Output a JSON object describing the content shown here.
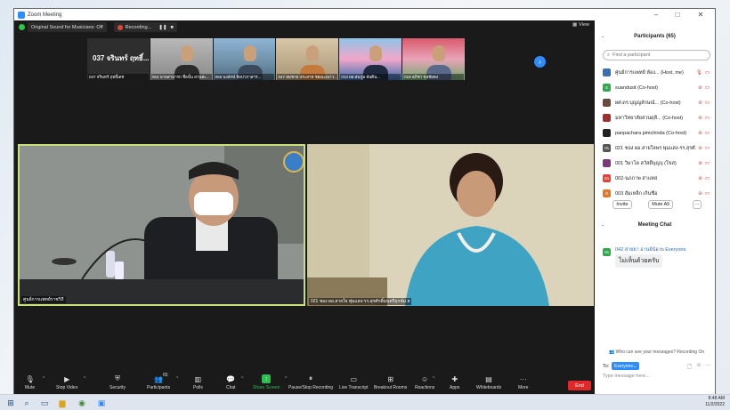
{
  "window": {
    "title": "Zoom Meeting",
    "minimize": "–",
    "maximize": "□",
    "close": "✕"
  },
  "topbar": {
    "sound_chip": "Original Sound for Musicians: Off",
    "recording": "Recording...",
    "pause": "❚❚",
    "stop": "■",
    "view": "View"
  },
  "thumbnails": [
    {
      "big_name": "037 จรินทร์ ฤทธิ์...",
      "label": "037 จรินทร์ ฤทธิ์เดช"
    },
    {
      "label": "054 นายสามารถ ชื่อนั้น สวนสะ..."
    },
    {
      "label": "055 นงลักษ์ สิลปาภาสาร..."
    },
    {
      "label": "047 สมชาย ประสาท ชยณะณาว..."
    },
    {
      "label": "013 ผอ.สมภูล สันติน..."
    },
    {
      "label": "019 อภิชา ชุลชัยคง"
    }
  ],
  "tiles": {
    "left_label": "ศูนย์การแพทย์ราชวิถี",
    "right_label": "021 ชอง ผอ.สายใจ พุ่มแสง-รร.สุรศักดิ์มนตรีฤกษ์ม ส"
  },
  "toolbar": {
    "mute": "Mute",
    "stop_video": "Stop Video",
    "security": "Security",
    "participants": "Participants",
    "participants_count": "65",
    "polls": "Polls",
    "chat": "Chat",
    "share_screen": "Share Screen",
    "pause_stop_recording": "Pause/Stop Recording",
    "live_transcript": "Live Transcript",
    "breakout_rooms": "Breakout Rooms",
    "reactions": "Reactions",
    "apps": "Apps",
    "whiteboards": "Whiteboards",
    "more": "More",
    "end": "End"
  },
  "participants_panel": {
    "title": "Participants (65)",
    "search_placeholder": "Find a participant",
    "items": [
      {
        "name": "ศูนย์การแพทย์ ห้อง... (Host, me)",
        "avatar": "img",
        "color": "#3a6fb0"
      },
      {
        "name": "suandusit (Co-host)",
        "avatar": "S",
        "color": "#2fa84f"
      },
      {
        "name": "ผศ.ดร.บุญญลักษณ์... (Co-host)",
        "avatar": "img",
        "color": "#6a4a3a"
      },
      {
        "name": "มหาวิทยาลัยสวนดุสิ... (Co-host)",
        "avatar": "img",
        "color": "#a03030"
      },
      {
        "name": "panpachara pimchinda (Co-host)",
        "avatar": "img",
        "color": "#222222"
      },
      {
        "name": "021 ชอง ผอ.สายใจพร พุ่มแสง-รร.สุรศั...",
        "avatar": "0s",
        "color": "#555555"
      },
      {
        "name": "001 วิษาโด สวัสดิ์บุญบุ (โขส)",
        "avatar": "img",
        "color": "#7a3a7a"
      },
      {
        "name": "002-นภภาพ สาแทส",
        "avatar": "0n",
        "color": "#e0443a"
      },
      {
        "name": "003 ส้มเหล็ก เกิ่นชื่อ",
        "avatar": "0",
        "color": "#e07a2a"
      }
    ],
    "invite": "Invite",
    "mute_all": "Mute All",
    "more": "···"
  },
  "chat_panel": {
    "title": "Meeting Chat",
    "message_from": "042 สายยา อานจ้น้อ to Everyone",
    "message_avatar": "0s",
    "message_text": "ไม่เห็นด้วยครับ",
    "who_can_see": "Who can see your messages? Recording On",
    "to_label": "To:",
    "to_value": "Everyone",
    "placeholder": "Type message here..."
  },
  "taskbar": {
    "time": "8:48 AM",
    "date": "11/2/2022"
  }
}
